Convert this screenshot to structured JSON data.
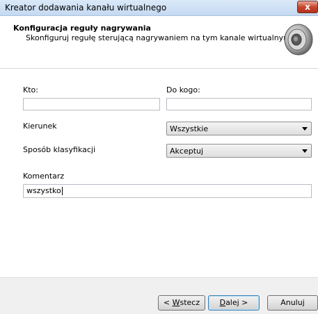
{
  "window": {
    "title": "Kreator dodawania kanału wirtualnego",
    "close": "x"
  },
  "header": {
    "title": "Konfiguracja reguły nagrywania",
    "subtitle": "Skonfiguruj regułę sterującą nagrywaniem na tym kanale wirtualnym.",
    "icon": "speaker-icon"
  },
  "form": {
    "kto_label": "Kto:",
    "kto_value": "",
    "do_kogo_label": "Do kogo:",
    "do_kogo_value": "",
    "kierunek_label": "Kierunek",
    "kierunek_value": "Wszystkie",
    "klasyfikacja_label": "Sposób klasyfikacji",
    "klasyfikacja_value": "Akceptuj",
    "komentarz_label": "Komentarz",
    "komentarz_value": "wszystko"
  },
  "buttons": {
    "back_prefix": "< ",
    "back_mnemonic": "W",
    "back_rest": "stecz",
    "next_mnemonic": "D",
    "next_rest": "alej >",
    "cancel": "Anuluj"
  }
}
